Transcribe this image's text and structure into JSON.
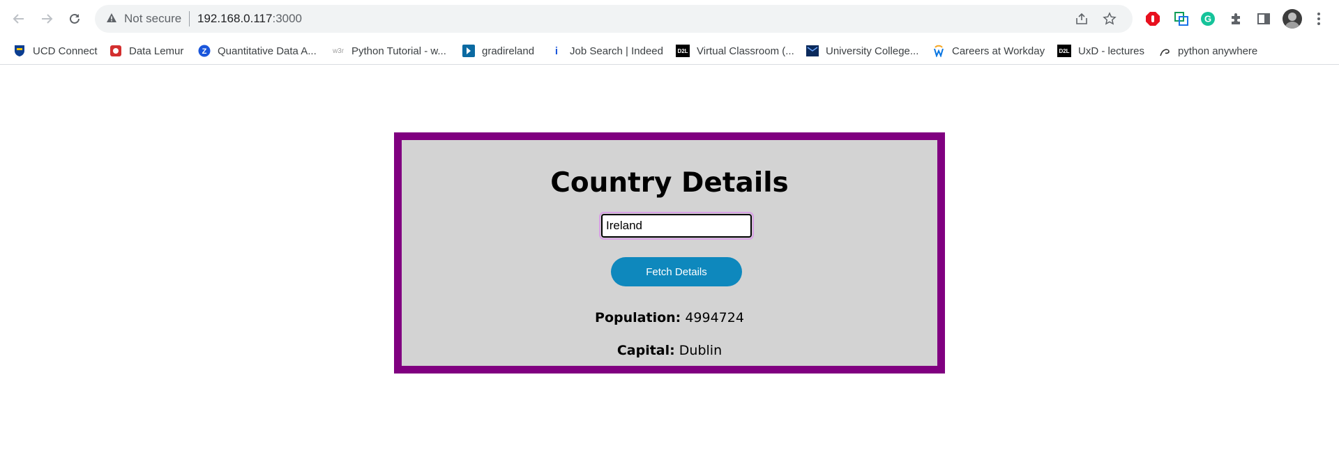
{
  "browser": {
    "security_label": "Not secure",
    "url_host": "192.168.0.117",
    "url_port": ":3000"
  },
  "bookmarks": [
    {
      "label": "UCD Connect",
      "icon": "ucd-crest-icon"
    },
    {
      "label": "Data Lemur",
      "icon": "data-lemur-icon"
    },
    {
      "label": "Quantitative Data A...",
      "icon": "zotero-icon"
    },
    {
      "label": "Python Tutorial - w...",
      "icon": "w3schools-icon"
    },
    {
      "label": "gradireland",
      "icon": "gradireland-icon"
    },
    {
      "label": "Job Search | Indeed",
      "icon": "indeed-icon"
    },
    {
      "label": "Virtual Classroom (...",
      "icon": "d2l-icon"
    },
    {
      "label": "University College...",
      "icon": "ucd-icon"
    },
    {
      "label": "Careers at Workday",
      "icon": "workday-icon"
    },
    {
      "label": "UxD - lectures",
      "icon": "d2l-icon"
    },
    {
      "label": "python anywhere",
      "icon": "pythonanywhere-icon"
    }
  ],
  "app": {
    "title": "Country Details",
    "input_value": "Ireland",
    "fetch_label": "Fetch Details",
    "population_label": "Population:",
    "population_value": "4994724",
    "capital_label": "Capital:",
    "capital_value": "Dublin"
  },
  "colors": {
    "card_border": "#800080",
    "card_background": "#d3d3d3",
    "button": "#0e88bd"
  }
}
